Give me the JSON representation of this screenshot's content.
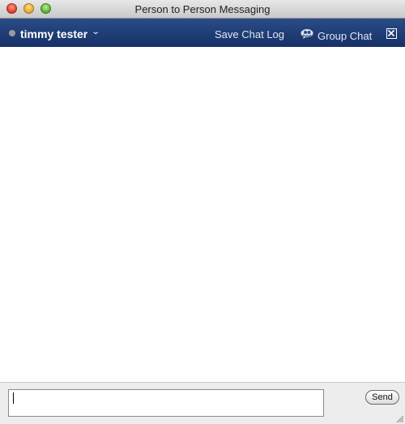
{
  "window": {
    "title": "Person to Person Messaging"
  },
  "header": {
    "contact_name": "timmy tester",
    "contact_status_color": "#9a9a9a",
    "save_chat_log_label": "Save Chat Log",
    "group_chat_label": "Group Chat",
    "icons": {
      "status": "status-dot-icon",
      "dropdown": "chevron-down-icon",
      "group_chat": "group-chat-icon",
      "close": "close-box-icon"
    }
  },
  "compose": {
    "input_value": "",
    "send_label": "Send"
  },
  "colors": {
    "header_background": "#1f3d78",
    "header_link": "#dfe7f5",
    "compose_background": "#ededed"
  }
}
